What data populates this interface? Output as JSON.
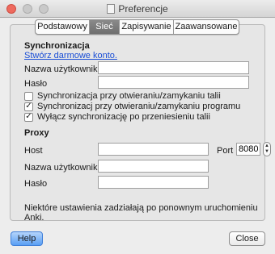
{
  "window": {
    "title": "Preferencje"
  },
  "tabs": [
    {
      "label": "Podstawowy",
      "active": false
    },
    {
      "label": "Sieć",
      "active": true
    },
    {
      "label": "Zapisywanie",
      "active": false
    },
    {
      "label": "Zaawansowane",
      "active": false
    }
  ],
  "sync": {
    "heading": "Synchronizacja",
    "create_account_link": "Stwórz darmowe konto.",
    "username_label": "Nazwa użytkownika",
    "username_value": "",
    "password_label": "Hasło",
    "password_value": "",
    "options": [
      {
        "label": "Synchronizacja przy otwieraniu/zamykaniu talii",
        "checked": false
      },
      {
        "label": "Synchronizacj przy otwieraniu/zamykaniu programu",
        "checked": true
      },
      {
        "label": "Wyłącz synchronizację po przeniesieniu talii",
        "checked": true
      }
    ]
  },
  "proxy": {
    "heading": "Proxy",
    "host_label": "Host",
    "host_value": "",
    "port_label": "Port",
    "port_value": "8080",
    "username_label": "Nazwa użytkownika",
    "username_value": "",
    "password_label": "Hasło",
    "password_value": ""
  },
  "notice": "Niektóre ustawienia zadziałają po ponownym uruchomieniu Anki.",
  "buttons": {
    "help": "Help",
    "close": "Close"
  },
  "colors": {
    "link": "#1a4ed6",
    "active_tab": "#7c7c7c",
    "primary_button": "#5a9ff4"
  },
  "icons": {
    "checked": "✓",
    "stepper_up": "▲",
    "stepper_down": "▼"
  }
}
